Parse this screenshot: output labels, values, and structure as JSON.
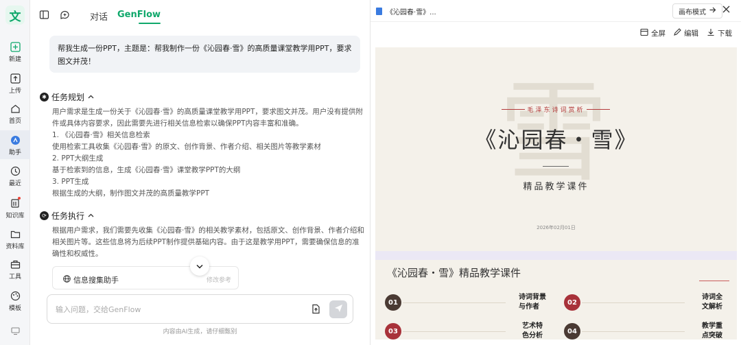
{
  "rail": {
    "logo": "文",
    "items": [
      {
        "label": "新建",
        "icon": "plus-square-icon"
      },
      {
        "label": "上传",
        "icon": "upload-icon"
      },
      {
        "label": "首页",
        "icon": "home-icon"
      },
      {
        "label": "助手",
        "icon": "assistant-icon"
      },
      {
        "label": "最近",
        "icon": "clock-icon"
      },
      {
        "label": "知识库",
        "icon": "knowledge-icon"
      },
      {
        "label": "资料库",
        "icon": "folder-icon"
      },
      {
        "label": "工具",
        "icon": "toolbox-icon"
      },
      {
        "label": "模板",
        "icon": "palette-icon"
      }
    ]
  },
  "chat": {
    "tabs": [
      {
        "label": "对话",
        "active": false
      },
      {
        "label": "GenFlow",
        "active": true
      }
    ],
    "user_message": "帮我生成一份PPT，主题是：帮我制作一份《沁园春·雪》的高质量课堂教学用PPT，要求图文并茂！",
    "plan": {
      "title": "任务规划",
      "lines": [
        "用户需求是生成一份关于《沁园春·雪》的高质量课堂教学用PPT，要求图文并茂。用户没有提供附件或具体内容要求，因此需要先进行相关信息检索以确保PPT内容丰富和准确。",
        "1. 《沁园春·雪》相关信息检索",
        "使用检索工具收集《沁园春·雪》的原文、创作背景、作者介绍、相关图片等教学素材",
        "2. PPT大纲生成",
        "基于检索到的信息，生成《沁园春·雪》课堂教学PPT的大纲",
        "3. PPT生成",
        "根据生成的大纲，制作图文并茂的高质量教学PPT"
      ]
    },
    "execution": {
      "title": "任务执行",
      "text": "根据用户需求，我们需要先收集《沁园春·雪》的相关教学素材，包括原文、创作背景、作者介绍和相关图片等。这些信息将为后续PPT制作提供基础内容。由于这是教学用PPT，需要确保信息的准确性和权威性。",
      "tool_card": {
        "title": "信息搜集助手",
        "right": "修改参考"
      }
    },
    "input": {
      "placeholder": "输入问题，交给GenFlow"
    },
    "disclaimer": "内容由AI生成，请仔细甄别"
  },
  "preview": {
    "tab_title": "《沁园春·雪》...",
    "canvas_mode": "画布模式",
    "actions": [
      {
        "label": "全屏",
        "icon": "fullscreen-icon"
      },
      {
        "label": "编辑",
        "icon": "edit-icon"
      },
      {
        "label": "下载",
        "icon": "download-icon"
      }
    ],
    "slide1": {
      "bg_char": "雪",
      "subtitle": "毛泽东诗词赏析",
      "title": "《沁园春・雪》",
      "tagline": "精品教学课件",
      "date": "2026年02月01日"
    },
    "slide2": {
      "title": "《沁园春・雪》精品教学课件",
      "toc": [
        {
          "num": "01",
          "line1": "诗词背景",
          "line2": "与作者",
          "color": "#4a3a33"
        },
        {
          "num": "02",
          "line1": "诗词全",
          "line2": "文解析",
          "color": "#a8323a"
        },
        {
          "num": "03",
          "line1": "艺术特",
          "line2": "色分析",
          "color": "#a8323a"
        },
        {
          "num": "04",
          "line1": "教学重",
          "line2": "点突破",
          "color": "#4a3a33"
        }
      ]
    }
  },
  "colors": {
    "brand": "#0fa86b",
    "accent_red": "#a8323a",
    "dark_brown": "#4a3a33"
  }
}
